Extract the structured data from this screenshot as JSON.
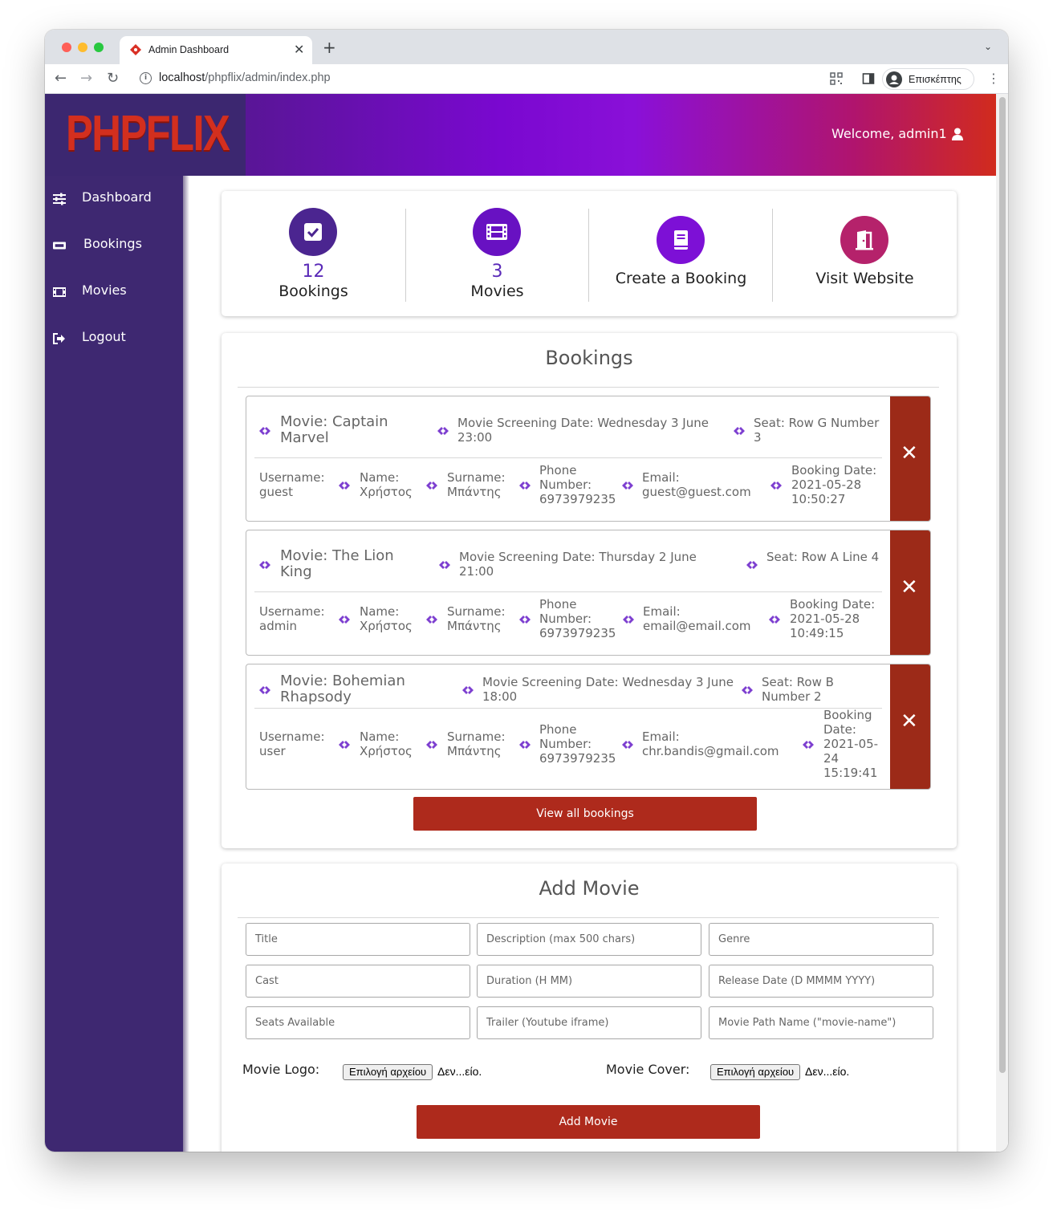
{
  "browser": {
    "tab_title": "Admin Dashboard",
    "url_host": "localhost",
    "url_path": "/phpflix/admin/index.php",
    "profile_name": "Επισκέπτης"
  },
  "header": {
    "logo": "PHPFLIX",
    "welcome": "Welcome, admin1"
  },
  "sidebar": {
    "items": [
      {
        "label": "Dashboard",
        "icon": "sliders-icon"
      },
      {
        "label": "Bookings",
        "icon": "ticket-icon"
      },
      {
        "label": "Movies",
        "icon": "film-icon"
      },
      {
        "label": "Logout",
        "icon": "sign-out-icon"
      }
    ]
  },
  "stats": {
    "bookings_count": "12",
    "bookings_label": "Bookings",
    "movies_count": "3",
    "movies_label": "Movies",
    "create_label": "Create a Booking",
    "visit_label": "Visit Website"
  },
  "bookings_section": {
    "title": "Bookings",
    "view_all": "View all bookings",
    "items": [
      {
        "movie": "Movie: Captain Marvel",
        "date": "Movie Screening Date: Wednesday 3 June 23:00",
        "seat": "Seat: Row G Number 3",
        "username": "Username: guest",
        "name": "Name: Χρήστος",
        "surname": "Surname: Μπάντης",
        "phone": "Phone Number: 6973979235",
        "email": "Email: guest@guest.com",
        "booking_date": "Booking Date: 2021-05-28 10:50:27"
      },
      {
        "movie": "Movie: The Lion King",
        "date": "Movie Screening Date: Thursday 2 June 21:00",
        "seat": "Seat: Row A Line 4",
        "username": "Username: admin",
        "name": "Name: Χρήστος",
        "surname": "Surname: Μπάντης",
        "phone": "Phone Number: 6973979235",
        "email": "Email: email@email.com",
        "booking_date": "Booking Date: 2021-05-28 10:49:15"
      },
      {
        "movie": "Movie: Bohemian Rhapsody",
        "date": "Movie Screening Date: Wednesday 3 June 18:00",
        "seat": "Seat: Row B Number 2",
        "username": "Username: user",
        "name": "Name: Χρήστος",
        "surname": "Surname: Μπάντης",
        "phone": "Phone Number: 6973979235",
        "email": "Email: chr.bandis@gmail.com",
        "booking_date": "Booking Date: 2021-05-24 15:19:41"
      }
    ]
  },
  "add_movie": {
    "title": "Add Movie",
    "placeholders": {
      "title": "Title",
      "description": "Description (max 500 chars)",
      "genre": "Genre",
      "cast": "Cast",
      "duration": "Duration (H MM)",
      "release_date": "Release Date (D MMMM YYYY)",
      "seats": "Seats Available",
      "trailer": "Trailer (Youtube iframe)",
      "path_name": "Movie Path Name (\"movie-name\")"
    },
    "logo_label": "Movie Logo:",
    "cover_label": "Movie Cover:",
    "file_button": "Επιλογή αρχείου",
    "file_status": "Δεν...είο.",
    "submit": "Add Movie"
  },
  "colors": {
    "sidebar": "#3e2871",
    "accent_purple": "#7a08d0",
    "danger_red": "#ae2a1c"
  }
}
